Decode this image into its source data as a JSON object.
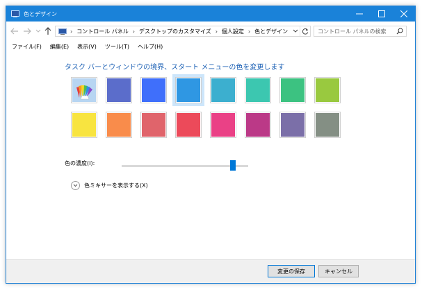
{
  "window": {
    "title": "色とデザイン"
  },
  "address": {
    "breadcrumbs": [
      "コントロール パネル",
      "デスクトップのカスタマイズ",
      "個人設定",
      "色とデザイン"
    ]
  },
  "search": {
    "placeholder": "コントロール パネルの検索"
  },
  "menu": [
    "ファイル(F)",
    "編集(E)",
    "表示(V)",
    "ツール(T)",
    "ヘルプ(H)"
  ],
  "heading": "タスク バーとウィンドウの境界、スタート メニューの色を変更します",
  "swatches": {
    "rows": [
      [
        "auto",
        "#5b6dcb",
        "#3f6ffb",
        "#2f97e3",
        "#3cafcf",
        "#3cc7b0",
        "#3cc281",
        "#99c93f"
      ],
      [
        "#f8e440",
        "#f98c4b",
        "#e0646b",
        "#ec4a5a",
        "#ea4186",
        "#bb3987",
        "#7b6fa8",
        "#848f84"
      ]
    ],
    "selected_index": 3
  },
  "intensity": {
    "label": "色の濃度(I):",
    "value_fraction": 0.88
  },
  "mixer": {
    "label": "色ミキサーを表示する(X)"
  },
  "buttons": {
    "save": "変更の保存",
    "cancel": "キャンセル"
  }
}
